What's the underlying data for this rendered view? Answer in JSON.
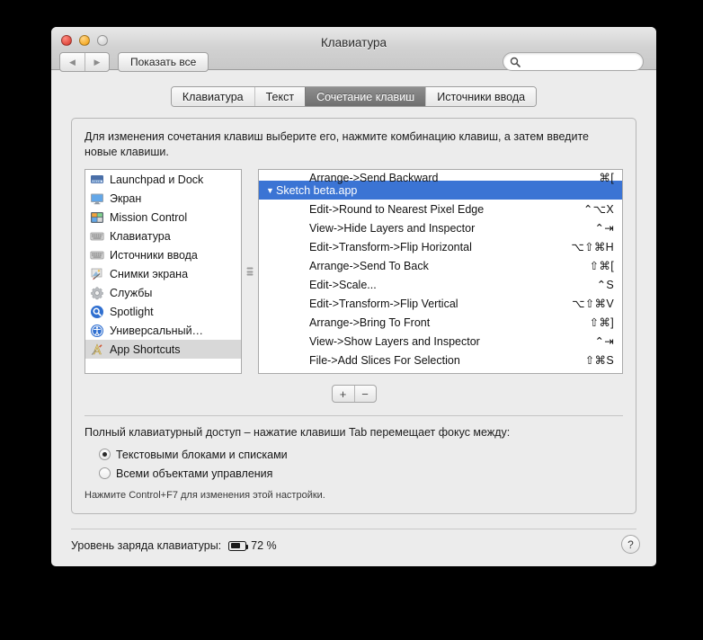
{
  "window": {
    "title": "Клавиатура",
    "traffic_lights": [
      "close",
      "minimize",
      "zoom"
    ],
    "back_glyph": "◀",
    "forward_glyph": "▶",
    "show_all_label": "Показать все",
    "search_placeholder": "",
    "search_value": "",
    "search_icon": "search-icon"
  },
  "tabs": [
    {
      "label": "Клавиатура",
      "active": false
    },
    {
      "label": "Текст",
      "active": false
    },
    {
      "label": "Сочетание клавиш",
      "active": true
    },
    {
      "label": "Источники ввода",
      "active": false
    }
  ],
  "hint": "Для изменения сочетания клавиш выберите его, нажмите комбинацию клавиш, а затем введите новые клавиши.",
  "sidebar": {
    "items": [
      {
        "label": "Launchpad и Dock",
        "icon": "launchpad-dock-icon",
        "selected": false
      },
      {
        "label": "Экран",
        "icon": "display-icon",
        "selected": false
      },
      {
        "label": "Mission Control",
        "icon": "mission-control-icon",
        "selected": false
      },
      {
        "label": "Клавиатура",
        "icon": "keyboard-icon",
        "selected": false
      },
      {
        "label": "Источники ввода",
        "icon": "keyboard-icon",
        "selected": false
      },
      {
        "label": "Снимки экрана",
        "icon": "screenshots-icon",
        "selected": false
      },
      {
        "label": "Службы",
        "icon": "gear-icon",
        "selected": false
      },
      {
        "label": "Spotlight",
        "icon": "spotlight-icon",
        "selected": false
      },
      {
        "label": "Универсальный…",
        "icon": "accessibility-icon",
        "selected": false
      },
      {
        "label": "App Shortcuts",
        "icon": "app-shortcuts-icon",
        "selected": true
      }
    ]
  },
  "shortcuts": {
    "rows": [
      {
        "title": "Arrange->Send Backward",
        "keys": "⌘[",
        "type": "item",
        "selected": false,
        "clipped": true
      },
      {
        "title": "Sketch beta.app",
        "keys": "",
        "type": "group",
        "selected": true,
        "disclosure": "▼"
      },
      {
        "title": "Edit->Round to Nearest Pixel Edge",
        "keys": "⌃⌥X",
        "type": "item",
        "selected": false
      },
      {
        "title": "View->Hide Layers and Inspector",
        "keys": "⌃⇥",
        "type": "item",
        "selected": false
      },
      {
        "title": "Edit->Transform->Flip Horizontal",
        "keys": "⌥⇧⌘H",
        "type": "item",
        "selected": false
      },
      {
        "title": "Arrange->Send To Back",
        "keys": "⇧⌘[",
        "type": "item",
        "selected": false
      },
      {
        "title": "Edit->Scale...",
        "keys": "⌃S",
        "type": "item",
        "selected": false
      },
      {
        "title": "Edit->Transform->Flip Vertical",
        "keys": "⌥⇧⌘V",
        "type": "item",
        "selected": false
      },
      {
        "title": "Arrange->Bring To Front",
        "keys": "⇧⌘]",
        "type": "item",
        "selected": false
      },
      {
        "title": "View->Show Layers and Inspector",
        "keys": "⌃⇥",
        "type": "item",
        "selected": false
      },
      {
        "title": "File->Add Slices For Selection",
        "keys": "⇧⌘S",
        "type": "item",
        "selected": false
      }
    ]
  },
  "list_buttons": {
    "add": "+",
    "remove": "−"
  },
  "full_keyboard_access": {
    "title": "Полный клавиатурный доступ – нажатие клавиши Tab перемещает фокус между:",
    "options": [
      {
        "label": "Текстовыми блоками и списками",
        "selected": true
      },
      {
        "label": "Всеми объектами управления",
        "selected": false
      }
    ],
    "note": "Нажмите Control+F7 для изменения этой настройки."
  },
  "footer": {
    "battery_label": "Уровень заряда клавиатуры:",
    "battery_percent": "72 %",
    "battery_fill": 72,
    "help_glyph": "?"
  },
  "colors": {
    "selection_blue": "#3b74d4",
    "sidebar_selection": "#d8d8d8",
    "window_bg": "#ececec"
  }
}
